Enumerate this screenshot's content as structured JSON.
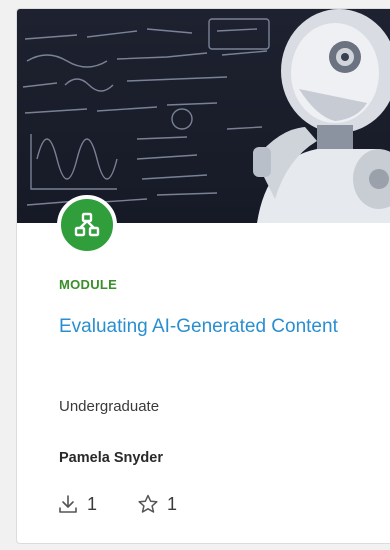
{
  "card": {
    "badge_icon": "module-icon",
    "type_label": "MODULE",
    "title": "Evaluating AI-Generated Content",
    "level": "Undergraduate",
    "author": "Pamela Snyder",
    "downloads": {
      "icon": "download-icon",
      "count": "1"
    },
    "favorites": {
      "icon": "star-icon",
      "count": "1"
    }
  },
  "colors": {
    "module_green": "#2f9e3b",
    "title_blue": "#2a8fd0",
    "label_green": "#3a8f2a"
  }
}
